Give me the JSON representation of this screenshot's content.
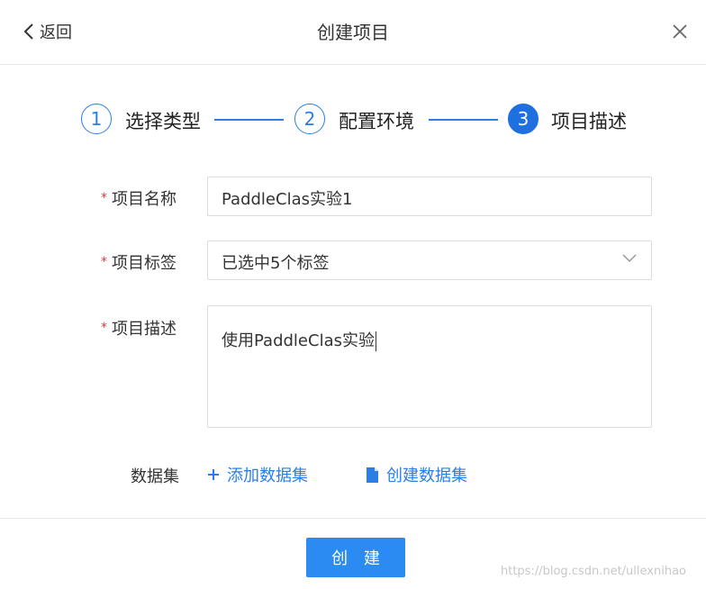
{
  "header": {
    "back_label": "返回",
    "title": "创建项目"
  },
  "steps": [
    {
      "number": "1",
      "label": "选择类型",
      "state": "done"
    },
    {
      "number": "2",
      "label": "配置环境",
      "state": "done"
    },
    {
      "number": "3",
      "label": "项目描述",
      "state": "active"
    }
  ],
  "form": {
    "required_mark": "*",
    "name_label": "项目名称",
    "name_value": "PaddleClas实验1",
    "tags_label": "项目标签",
    "tags_value": "已选中5个标签",
    "desc_label": "项目描述",
    "desc_value": "使用PaddleClas实验",
    "dataset_label": "数据集",
    "add_dataset_label": "添加数据集",
    "create_dataset_label": "创建数据集"
  },
  "footer": {
    "create_button": "创 建"
  },
  "watermark": "https://blog.csdn.net/ullexnihao",
  "colors": {
    "accent": "#2b7ee6",
    "primary_button": "#2b8bf3",
    "required": "#e0383e"
  },
  "icons": [
    "chevron-left-icon",
    "close-icon",
    "chevron-down-icon",
    "plus-icon",
    "file-icon"
  ]
}
